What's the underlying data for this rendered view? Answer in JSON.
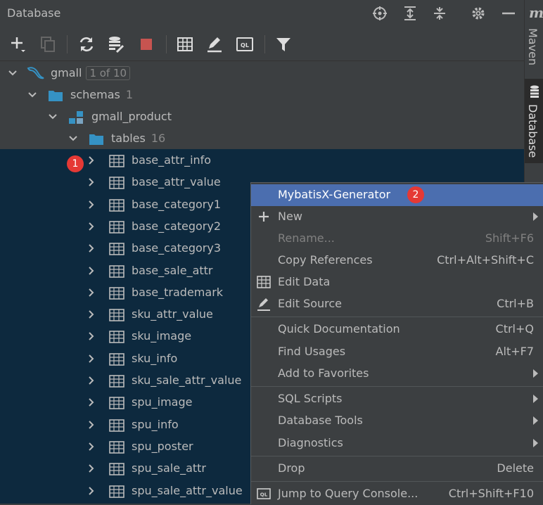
{
  "panel": {
    "title": "Database"
  },
  "sidebar": {
    "maven_logo": "m",
    "maven": "Maven",
    "database": "Database"
  },
  "tree": {
    "root": {
      "label": "gmall",
      "counter": "1 of 10"
    },
    "schemas": {
      "label": "schemas",
      "count": "1"
    },
    "schema": {
      "label": "gmall_product"
    },
    "tables": {
      "label": "tables",
      "count": "16"
    },
    "items": [
      "base_attr_info",
      "base_attr_value",
      "base_category1",
      "base_category2",
      "base_category3",
      "base_sale_attr",
      "base_trademark",
      "sku_attr_value",
      "sku_image",
      "sku_info",
      "sku_sale_attr_value",
      "spu_image",
      "spu_info",
      "spu_poster",
      "spu_sale_attr",
      "spu_sale_attr_value"
    ]
  },
  "badges": {
    "one": "1",
    "two": "2"
  },
  "context_menu": {
    "mybatis": "MybatisX-Generator",
    "new": "New",
    "rename": "Rename...",
    "rename_sc": "Shift+F6",
    "copy_refs": "Copy References",
    "copy_refs_sc": "Ctrl+Alt+Shift+C",
    "edit_data": "Edit Data",
    "edit_source": "Edit Source",
    "edit_source_sc": "Ctrl+B",
    "quick_doc": "Quick Documentation",
    "quick_doc_sc": "Ctrl+Q",
    "find_usages": "Find Usages",
    "find_usages_sc": "Alt+F7",
    "add_fav": "Add to Favorites",
    "sql_scripts": "SQL Scripts",
    "db_tools": "Database Tools",
    "diagnostics": "Diagnostics",
    "drop": "Drop",
    "drop_sc": "Delete",
    "jump": "Jump to Query Console...",
    "jump_sc": "Ctrl+Shift+F10"
  },
  "colors": {
    "accent": "#4b6eaf",
    "selection": "#0d293e",
    "badge": "#e53935",
    "folder": "#3592c4"
  }
}
